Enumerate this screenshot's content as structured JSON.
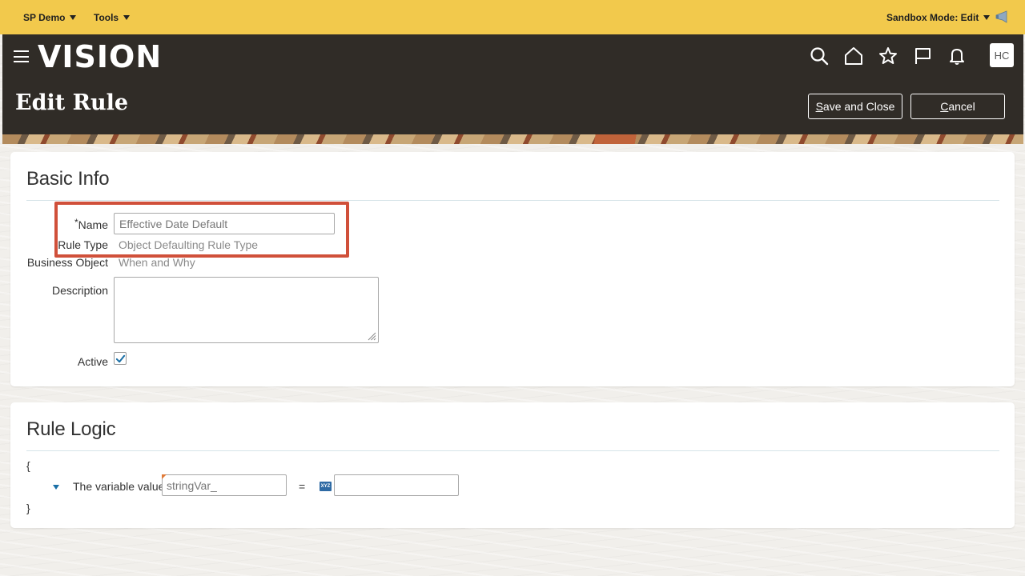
{
  "topbar": {
    "menu1": "SP Demo",
    "menu2": "Tools",
    "sandbox": "Sandbox Mode: Edit"
  },
  "header": {
    "logo": "VISION",
    "avatar": "HC",
    "page_title": "Edit Rule",
    "save_close_rest": "ave and Close",
    "save_close_mnemonic": "S",
    "cancel_rest": "ancel",
    "cancel_mnemonic": "C"
  },
  "basic_info": {
    "title": "Basic Info",
    "name_required": "*",
    "name_label": "Name",
    "name_value": "Effective Date Default",
    "rule_type_label": "Rule Type",
    "rule_type_value": "Object Defaulting Rule Type",
    "business_object_label": "Business Object",
    "business_object_value": "When and Why",
    "description_label": "Description",
    "active_label": "Active",
    "active_checked": true
  },
  "rule_logic": {
    "title": "Rule Logic",
    "open_brace": "{",
    "close_brace": "}",
    "variable_label": "The variable value",
    "variable_value": "stringVar_",
    "operator": "=",
    "type_badge": "XYZ",
    "value": ""
  },
  "colors": {
    "topbar": "#f2c94c",
    "header": "#302c27",
    "highlight": "#d0503a",
    "accent": "#1a6fa6"
  }
}
